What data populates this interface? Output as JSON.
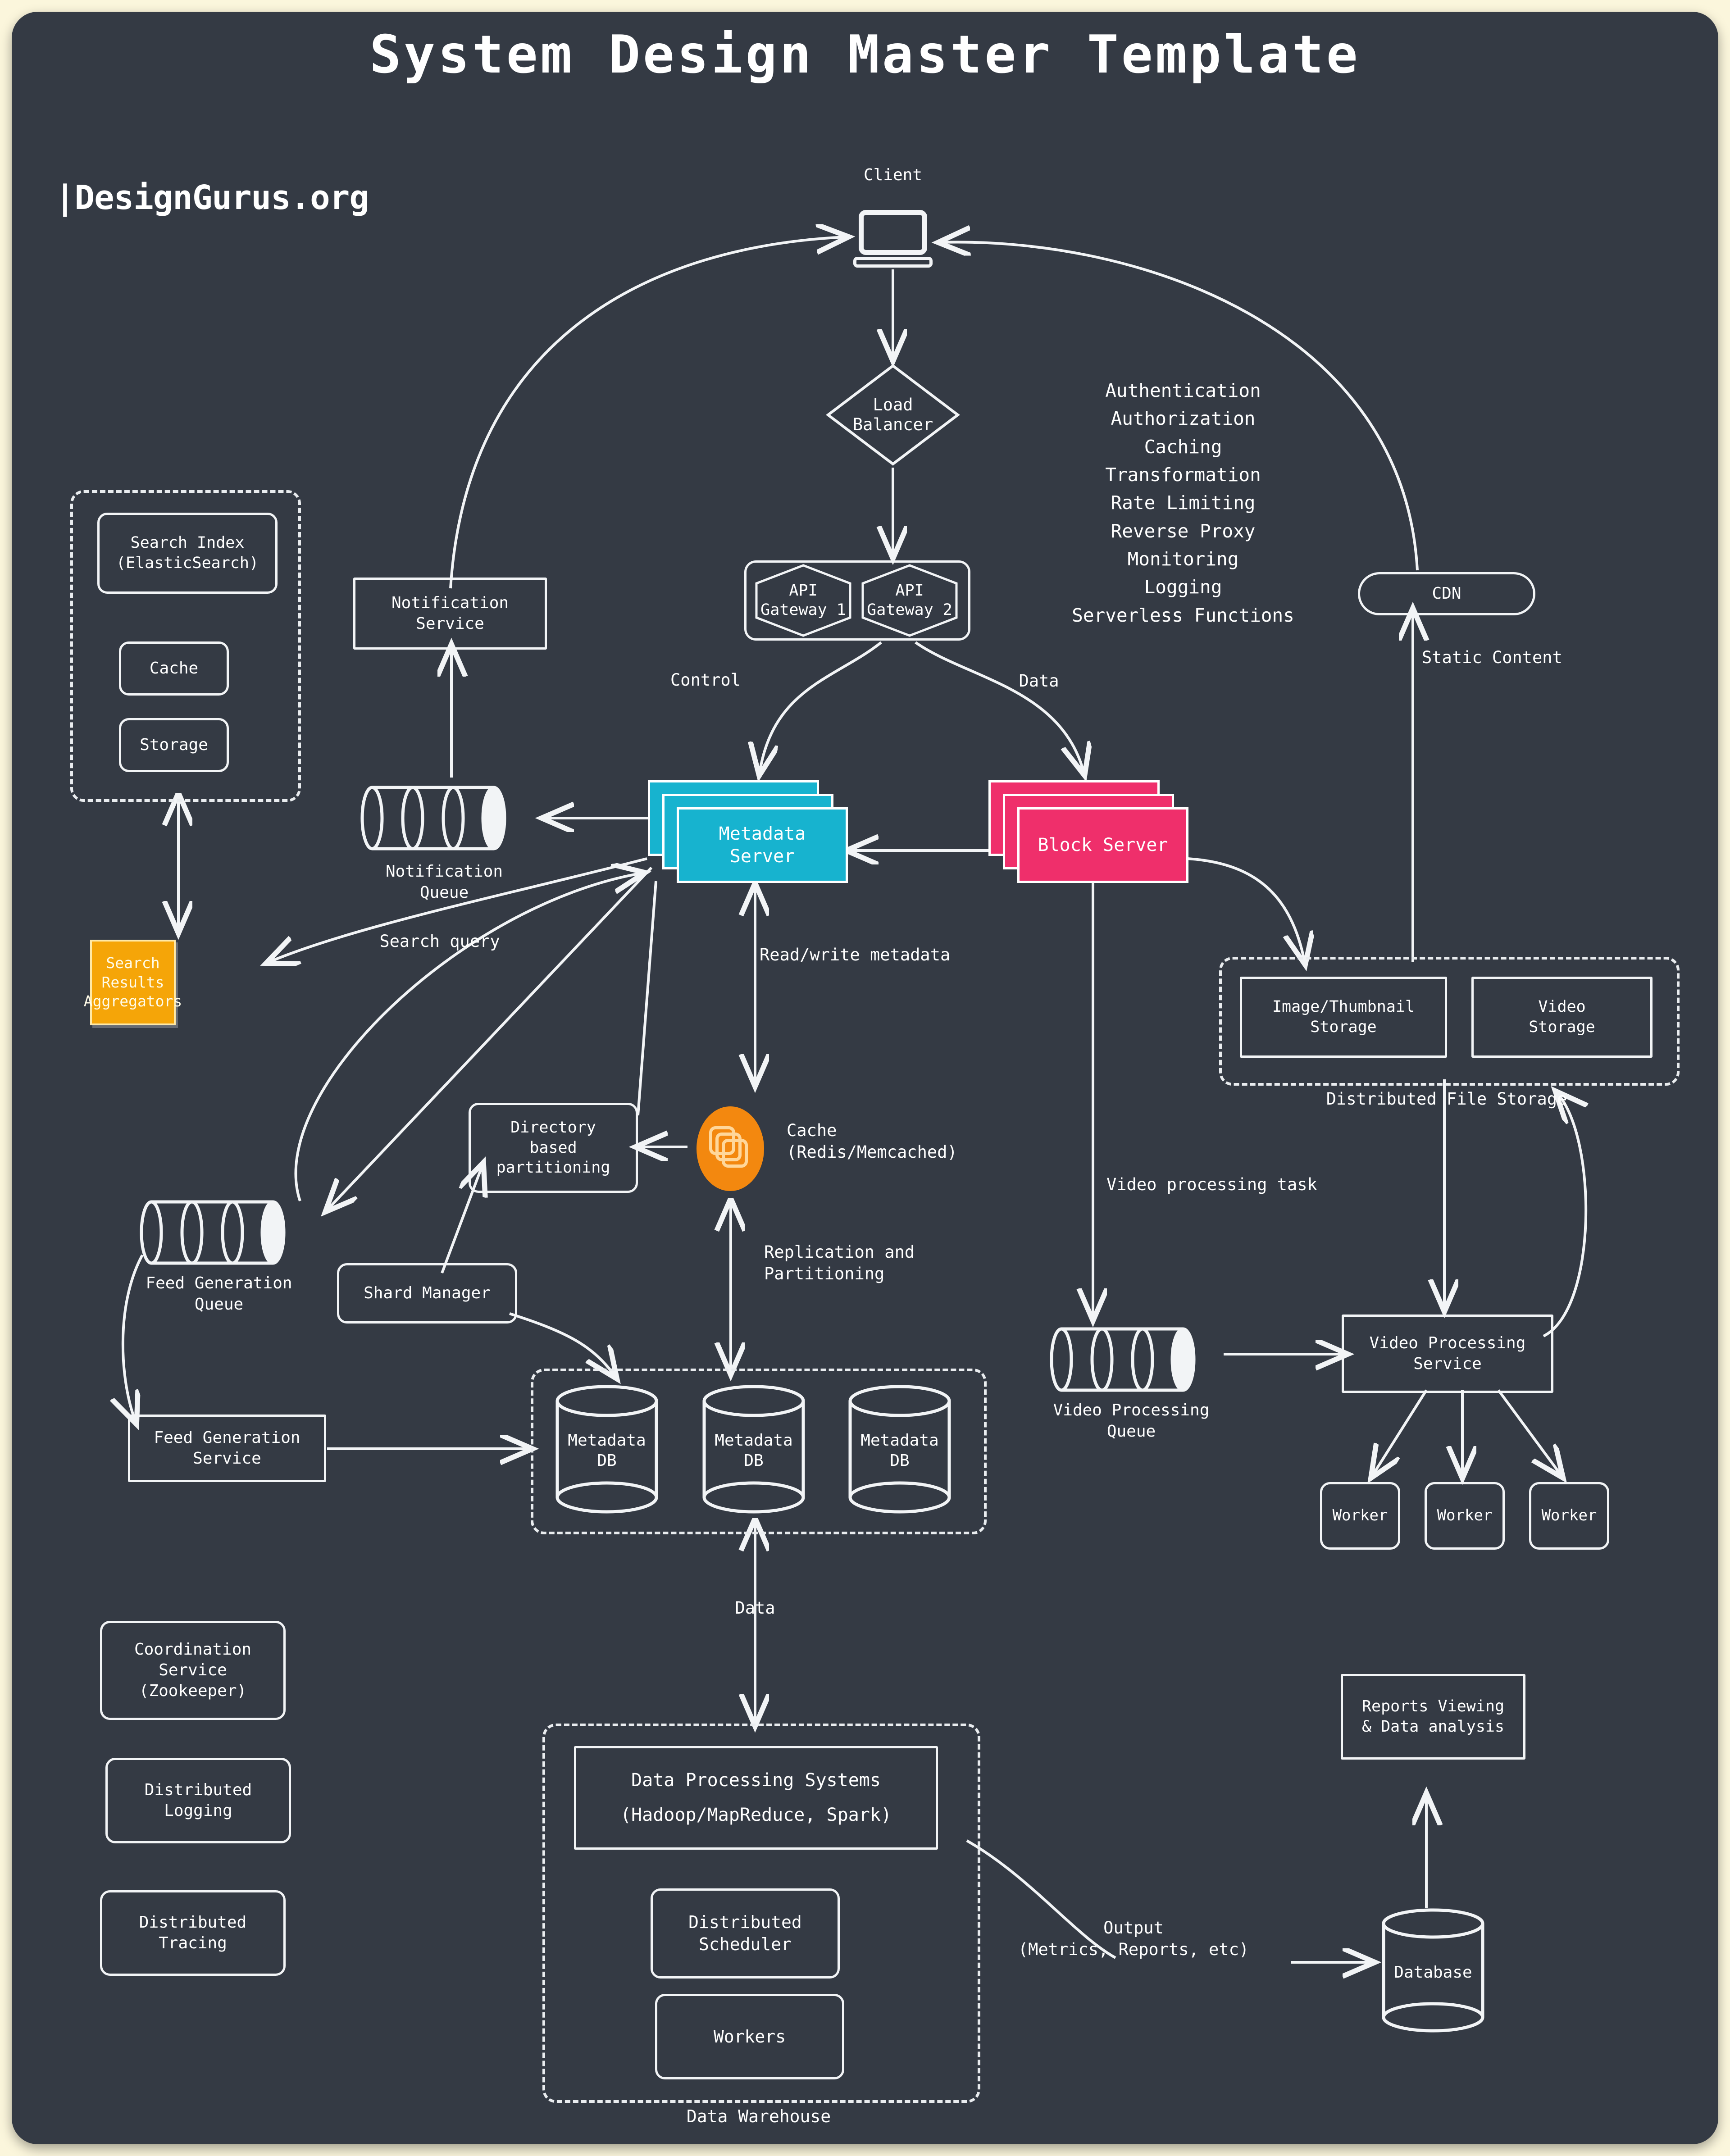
{
  "title": "System Design Master Template",
  "brand": "|DesignGurus.org",
  "colors": {
    "page_background": "#fbf6dc",
    "panel_background": "#343a44",
    "stroke": "#f2f4f6",
    "metadata_server": "#17b3cf",
    "block_server": "#ef2f6b",
    "cache": "#f3880f",
    "search_results_aggregators": "#f5a508"
  },
  "nodes": {
    "client": "Client",
    "load_balancer": "Load\nBalancer",
    "api_gateway_1": "API\nGateway 1",
    "api_gateway_2": "API\nGateway 2",
    "cdn": "CDN",
    "notification_service": "Notification\nService",
    "notification_queue": "Notification\nQueue",
    "search_index": "Search Index\n(ElasticSearch)",
    "search_cache": "Cache",
    "search_storage": "Storage",
    "search_results_aggregators": "Search\nResults\nAggregators",
    "metadata_server": "Metadata\nServer",
    "block_server": "Block Server",
    "image_thumbnail_storage": "Image/Thumbnail\nStorage",
    "video_storage": "Video\nStorage",
    "distributed_file_storage": "Distributed File Storage",
    "cache": "Cache\n(Redis/Memcached)",
    "directory_based_partitioning": "Directory\nbased\npartitioning",
    "shard_manager": "Shard Manager",
    "feed_generation_queue": "Feed Generation\nQueue",
    "feed_generation_service": "Feed Generation\nService",
    "metadata_db_1": "Metadata\nDB",
    "metadata_db_2": "Metadata\nDB",
    "metadata_db_3": "Metadata\nDB",
    "video_processing_queue": "Video Processing\nQueue",
    "video_processing_service": "Video Processing\nService",
    "worker_1": "Worker",
    "worker_2": "Worker",
    "worker_3": "Worker",
    "coordination_service": "Coordination\nService\n(Zookeeper)",
    "distributed_logging": "Distributed\nLogging",
    "distributed_tracing": "Distributed\nTracing",
    "data_processing_systems": "Data Processing Systems",
    "data_processing_systems_sub": "(Hadoop/MapReduce, Spark)",
    "distributed_scheduler": "Distributed\nScheduler",
    "warehouse_workers": "Workers",
    "data_warehouse": "Data Warehouse",
    "reports_viewing": "Reports Viewing\n& Data analysis",
    "database": "Database"
  },
  "gateway_features": [
    "Authentication",
    "Authorization",
    "Caching",
    "Transformation",
    "Rate Limiting",
    "Reverse Proxy",
    "Monitoring",
    "Logging",
    "Serverless Functions"
  ],
  "edge_labels": {
    "control": "Control",
    "data": "Data",
    "static_content": "Static Content",
    "search_query": "Search query",
    "read_write_metadata": "Read/write metadata",
    "replication_partitioning": "Replication and\nPartitioning",
    "video_processing_task": "Video processing task",
    "data_to_warehouse": "Data",
    "output": "Output\n(Metrics, Reports, etc)"
  }
}
